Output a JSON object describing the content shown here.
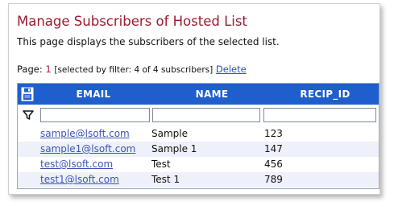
{
  "title": "Manage Subscribers of Hosted List",
  "description": "This page displays the subscribers of the selected list.",
  "pager": {
    "label": "Page:",
    "page": "1",
    "filter_info": "[selected by filter: 4 of 4 subscribers]",
    "delete_label": "Delete"
  },
  "table": {
    "columns": [
      "EMAIL",
      "NAME",
      "RECIP_ID"
    ],
    "filters": {
      "email": "",
      "name": "",
      "recip_id": ""
    },
    "rows": [
      {
        "email": "sample@lsoft.com",
        "name": "Sample",
        "recip_id": "123"
      },
      {
        "email": "sample1@lsoft.com",
        "name": "Sample 1",
        "recip_id": "147"
      },
      {
        "email": "test@lsoft.com",
        "name": "Test",
        "recip_id": "456"
      },
      {
        "email": "test1@lsoft.com",
        "name": "Test 1",
        "recip_id": "789"
      }
    ]
  },
  "icons": {
    "header_left": "save-icon",
    "filter_row": "filter-funnel-icon"
  },
  "colors": {
    "title": "#9b1b30",
    "header_bg": "#1f5ecd",
    "link": "#3a55b5",
    "page_number": "#c0182d"
  }
}
